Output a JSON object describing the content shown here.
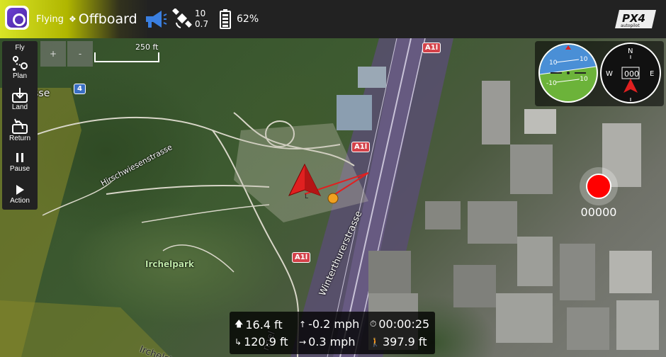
{
  "toolbar": {
    "status": "Flying",
    "flight_mode": "Offboard",
    "gps_satellites": "10",
    "gps_hdop": "0.7",
    "battery": "62%",
    "brand_logo": "PX4 autopilot"
  },
  "left_tools": [
    {
      "label": "Fly",
      "icon": "fly-icon"
    },
    {
      "label": "Plan",
      "icon": "plan-route-icon"
    },
    {
      "label": "Land",
      "icon": "land-icon"
    },
    {
      "label": "Return",
      "icon": "return-icon"
    },
    {
      "label": "Pause",
      "icon": "pause-icon"
    },
    {
      "label": "Action",
      "icon": "play-icon"
    }
  ],
  "map": {
    "zoom_in": "+",
    "zoom_out": "-",
    "scale": "250 ft",
    "labels": {
      "street_1": "strasse",
      "street_2": "Hirschwiesenstrasse",
      "street_3": "Winterthurerstrasse",
      "park": "Irchelpark",
      "tunnel": "nnel",
      "street_4": "Irchelst"
    },
    "road_signs": [
      "A1l",
      "A1l",
      "A1l"
    ],
    "route_sign": "4",
    "home_marker": "L"
  },
  "instruments": {
    "attitude_ticks": [
      "10",
      "10",
      "-10",
      "-10"
    ],
    "compass": {
      "north": "N",
      "west": "W",
      "east": "E",
      "heading": "000"
    }
  },
  "recording": {
    "counter": "00000"
  },
  "telemetry": {
    "altitude": "16.4 ft",
    "vertical_speed": "-0.2 mph",
    "flight_time": "00:00:25",
    "distance_home": "120.9 ft",
    "ground_speed": "0.3 mph",
    "distance": "397.9 ft"
  },
  "colors": {
    "toolbar_bg": "#222222",
    "status_yellow": "#d8e426",
    "record_red": "#ff0000",
    "vehicle_red": "#e02020",
    "sky_blue": "#4a8fd6",
    "ground_green": "#6cb33a"
  }
}
